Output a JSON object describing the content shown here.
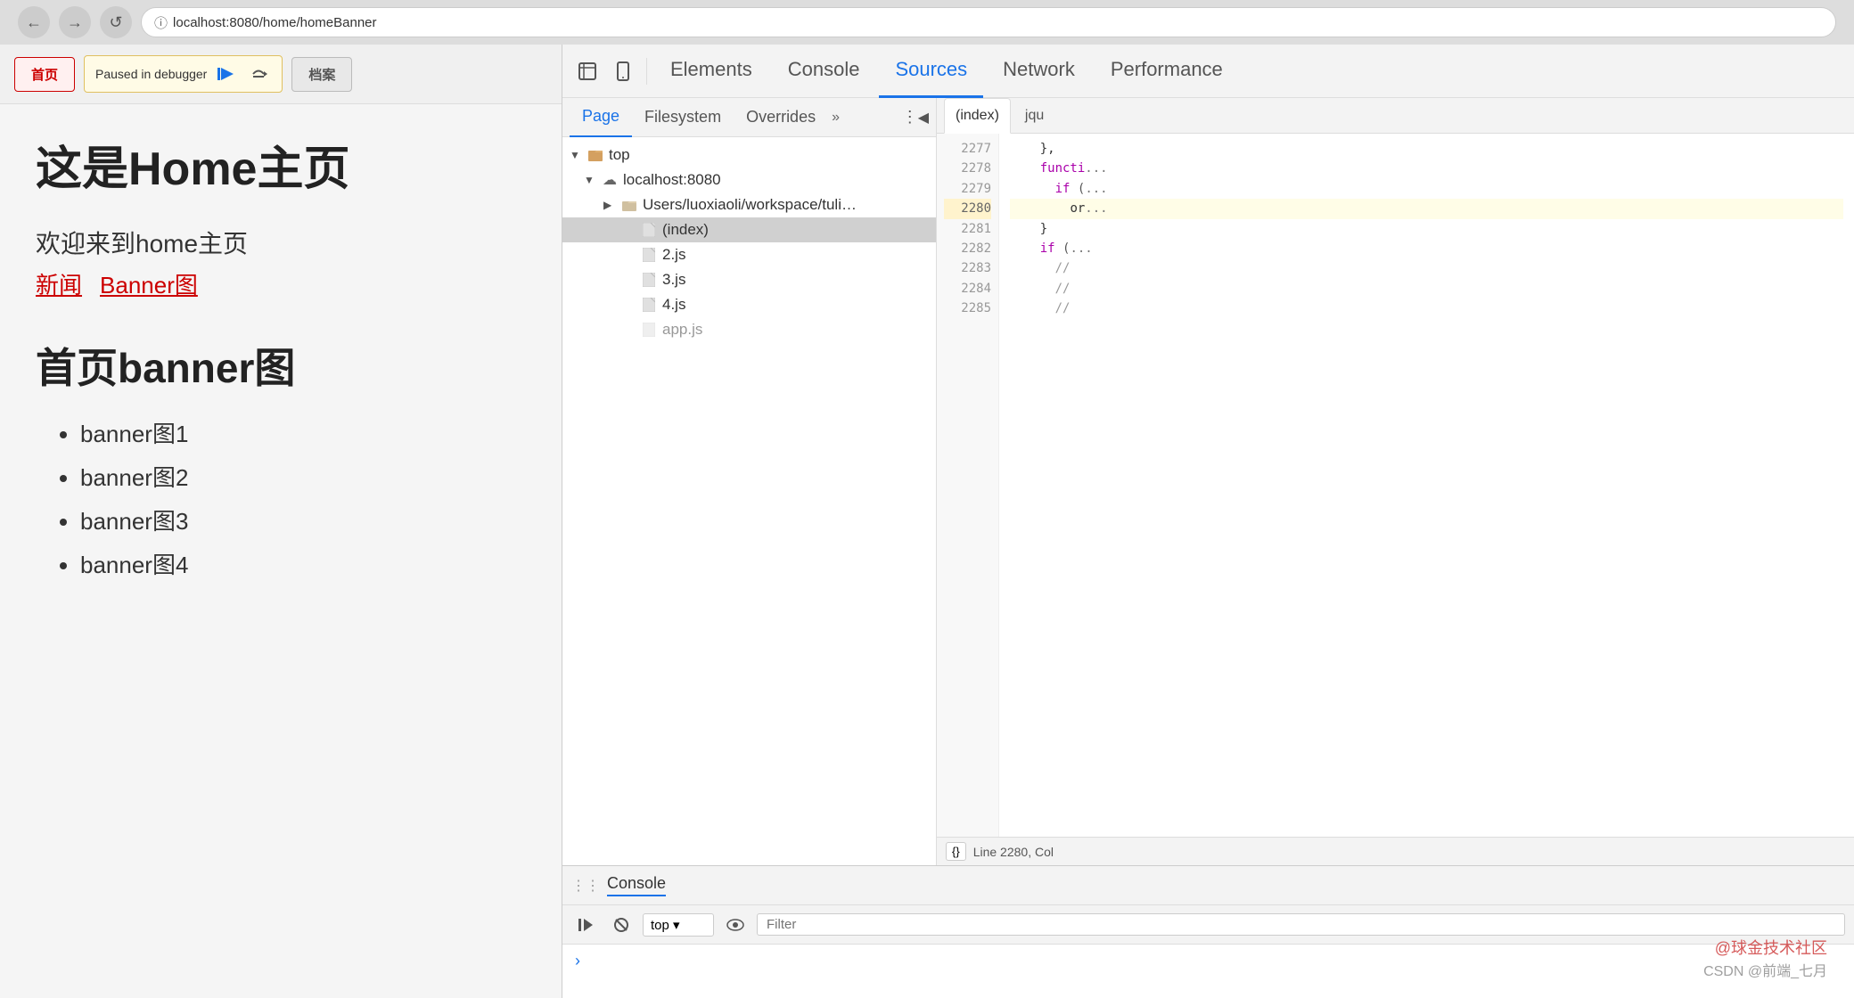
{
  "browser": {
    "address": "localhost:8080/home/homeBanner",
    "back_btn": "←",
    "forward_btn": "→",
    "reload_btn": "↺"
  },
  "toolbar": {
    "home_btn": "首页",
    "debugger_text": "Paused in debugger",
    "archive_btn": "档案",
    "resume_icon": "▶",
    "step_icon": "↩"
  },
  "page": {
    "main_title": "这是Home主页",
    "subtitle": "欢迎来到home主页",
    "link1": "新闻",
    "link2": "Banner图",
    "section_title": "首页banner图",
    "list_items": [
      "banner图1",
      "banner图2",
      "banner图3",
      "banner图4"
    ]
  },
  "devtools": {
    "tabs": [
      "Elements",
      "Console",
      "Sources",
      "Network",
      "Performance"
    ],
    "active_tab": "Sources",
    "inspect_icon": "⬚",
    "device_icon": "📱"
  },
  "sources": {
    "tabs": [
      "Page",
      "Filesystem",
      "Overrides"
    ],
    "active_tab": "Page",
    "tree": {
      "root": "top",
      "server": "localhost:8080",
      "folder": "Users/luoxiaoli/workspace/tuling/workspace/vue...",
      "files": [
        "(index)",
        "2.js",
        "3.js",
        "4.js"
      ]
    }
  },
  "code": {
    "tabs": [
      "(index)",
      "jqu"
    ],
    "active_tab": "(index)",
    "lines": [
      {
        "num": "2277",
        "content": "    },"
      },
      {
        "num": "2278",
        "content": "    functi"
      },
      {
        "num": "2279",
        "content": "      if ("
      },
      {
        "num": "2280",
        "content": "        or"
      },
      {
        "num": "2281",
        "content": "    }"
      },
      {
        "num": "2282",
        "content": "    if ("
      },
      {
        "num": "2283",
        "content": "      //"
      },
      {
        "num": "2284",
        "content": "      //"
      },
      {
        "num": "2285",
        "content": "      //"
      }
    ],
    "status": "Line 2280, Col",
    "format_btn": "{}"
  },
  "console": {
    "title": "Console",
    "context_value": "top",
    "filter_placeholder": "Filter",
    "resume_icon": "▶",
    "block_icon": "⊘",
    "eye_icon": "👁",
    "chevron": "›"
  },
  "watermark": {
    "line1": "@球金技术社区",
    "line2": "CSDN @前端_七月"
  }
}
